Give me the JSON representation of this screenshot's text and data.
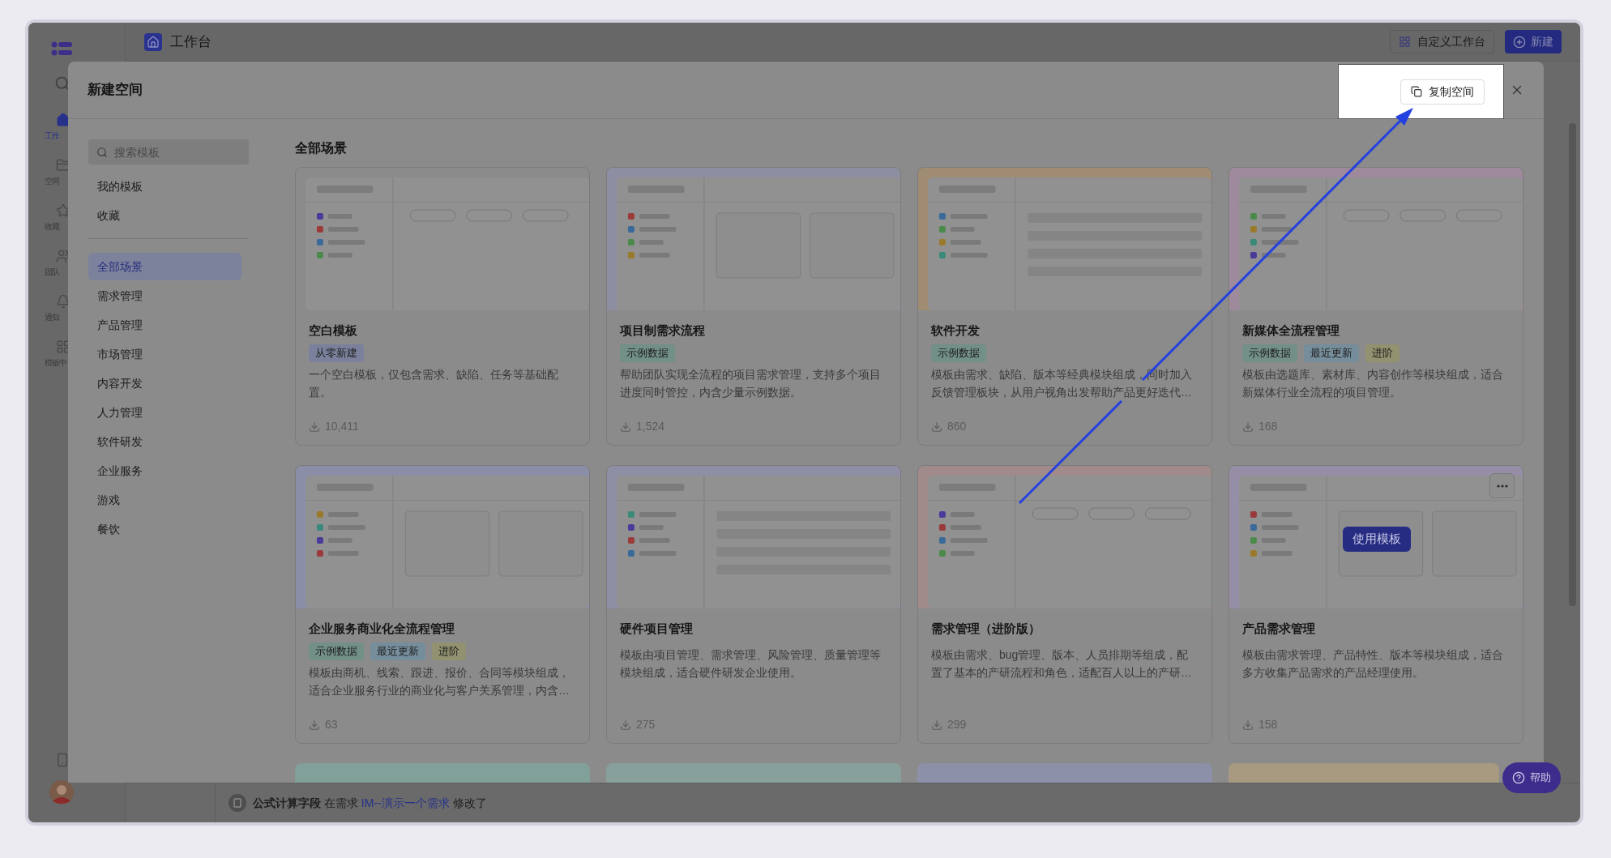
{
  "app": {
    "title": "工作台",
    "customize_button": "自定义工作台",
    "new_button": "新建",
    "rail": [
      {
        "label": "工作",
        "selected": true
      },
      {
        "label": "空间",
        "selected": false
      },
      {
        "label": "收藏",
        "selected": false
      },
      {
        "label": "团队",
        "selected": false
      },
      {
        "label": "通知",
        "selected": false
      },
      {
        "label": "模板中",
        "selected": false
      }
    ],
    "activity": {
      "subject": "公式计算字段",
      "middle": "在需求",
      "link": "IM--演示一个需求",
      "end": "修改了"
    }
  },
  "modal": {
    "title": "新建空间",
    "copy_button": "复制空间",
    "search": {
      "placeholder": "搜索模板"
    },
    "personal": [
      "我的模板",
      "收藏"
    ],
    "categories": [
      {
        "label": "全部场景",
        "selected": true
      },
      {
        "label": "需求管理",
        "selected": false
      },
      {
        "label": "产品管理",
        "selected": false
      },
      {
        "label": "市场管理",
        "selected": false
      },
      {
        "label": "内容开发",
        "selected": false
      },
      {
        "label": "人力管理",
        "selected": false
      },
      {
        "label": "软件研发",
        "selected": false
      },
      {
        "label": "企业服务",
        "selected": false
      },
      {
        "label": "游戏",
        "selected": false
      },
      {
        "label": "餐饮",
        "selected": false
      }
    ],
    "section_title": "全部场景",
    "use_template_label": "使用模板",
    "cards": [
      {
        "title": "空白模板",
        "tags": [
          {
            "label": "从零新建",
            "color": "#7b819c"
          }
        ],
        "description": "一个空白模板，仅包含需求、缺陷、任务等基础配置。",
        "downloads": "10,411",
        "color": "#8b8b8b",
        "hovered": false
      },
      {
        "title": "项目制需求流程",
        "tags": [
          {
            "label": "示例数据",
            "color": "#728f88"
          }
        ],
        "description": "帮助团队实现全流程的项目需求管理，支持多个项目进度同时管控，内含少量示例数据。",
        "downloads": "1,524",
        "color": "#8e8ea2",
        "hovered": false
      },
      {
        "title": "软件开发",
        "tags": [
          {
            "label": "示例数据",
            "color": "#728f88"
          }
        ],
        "description": "模板由需求、缺陷、版本等经典模块组成，同时加入反馈管理板块，从用户视角出发帮助产品更好迭代…",
        "downloads": "860",
        "color": "#a08c72",
        "hovered": false
      },
      {
        "title": "新媒体全流程管理",
        "tags": [
          {
            "label": "示例数据",
            "color": "#728f88"
          },
          {
            "label": "最近更新",
            "color": "#768d9b"
          },
          {
            "label": "进阶",
            "color": "#929270"
          }
        ],
        "description": "模板由选题库、素材库、内容创作等模块组成，适合新媒体行业全流程的项目管理。",
        "downloads": "168",
        "color": "#9e8a9c",
        "hovered": false
      },
      {
        "title": "企业服务商业化全流程管理",
        "tags": [
          {
            "label": "示例数据",
            "color": "#728f88"
          },
          {
            "label": "最近更新",
            "color": "#768d9b"
          },
          {
            "label": "进阶",
            "color": "#929270"
          }
        ],
        "description": "模板由商机、线索、跟进、报价、合同等模块组成，适合企业服务行业的商业化与客户关系管理，内含…",
        "downloads": "63",
        "color": "#8a8ea6",
        "hovered": false
      },
      {
        "title": "硬件项目管理",
        "description": "模板由项目管理、需求管理、风险管理、质量管理等模块组成，适合硬件研发企业使用。",
        "downloads": "275",
        "color": "#8e8ea4",
        "hovered": false
      },
      {
        "title": "需求管理（进阶版）",
        "description": "模板由需求、bug管理、版本、人员排期等组成，配置了基本的产研流程和角色，适配百人以上的产研…",
        "downloads": "299",
        "color": "#a08a8a",
        "hovered": false
      },
      {
        "title": "产品需求管理",
        "description": "模板由需求管理、产品特性、版本等模块组成，适合多方收集产品需求的产品经理使用。",
        "downloads": "158",
        "color": "#968ea6",
        "hovered": true
      }
    ],
    "more_cards": [
      {
        "color": "#82a09a"
      },
      {
        "color": "#88a09c"
      },
      {
        "color": "#8c90a8"
      },
      {
        "color": "#a89a80"
      }
    ]
  },
  "help_button": "帮助"
}
